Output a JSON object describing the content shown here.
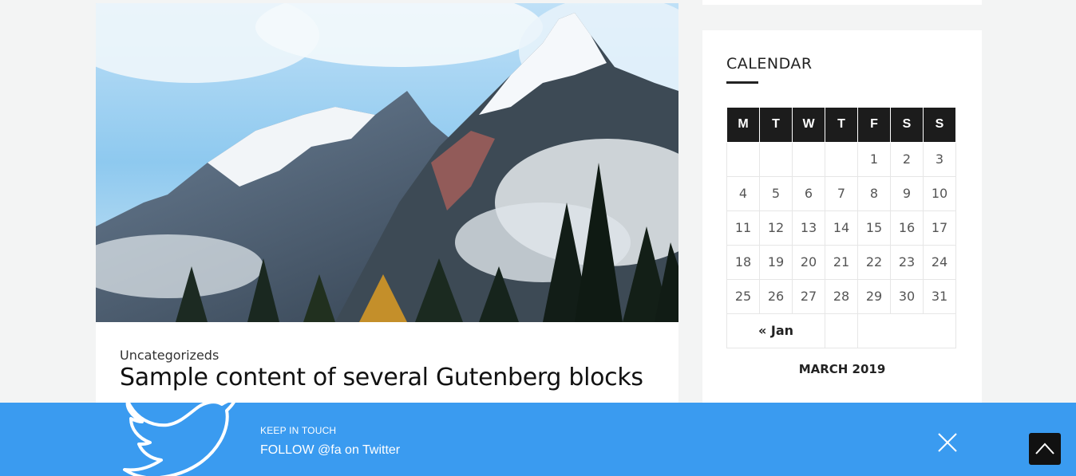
{
  "post": {
    "category": "Uncategorizeds",
    "title": "Sample content of several Gutenberg blocks",
    "image_icon": "mountain-landscape-photo"
  },
  "sidebar": {
    "calendar": {
      "title": "CALENDAR",
      "weekdays": [
        "M",
        "T",
        "W",
        "T",
        "F",
        "S",
        "S"
      ],
      "weeks": [
        [
          "",
          "",
          "",
          "",
          "1",
          "2",
          "3"
        ],
        [
          "4",
          "5",
          "6",
          "7",
          "8",
          "9",
          "10"
        ],
        [
          "11",
          "12",
          "13",
          "14",
          "15",
          "16",
          "17"
        ],
        [
          "18",
          "19",
          "20",
          "21",
          "22",
          "23",
          "24"
        ],
        [
          "25",
          "26",
          "27",
          "28",
          "29",
          "30",
          "31"
        ]
      ],
      "prev_link": "« Jan",
      "caption": "MARCH 2019"
    }
  },
  "twitter_bar": {
    "keep_label": "KEEP IN TOUCH",
    "follow_text": "FOLLOW @fa on Twitter",
    "bird_icon": "twitter-bird-icon",
    "close_icon": "close-icon",
    "background": "#3a9bf0"
  },
  "scroll_top": {
    "icon": "chevron-up-icon"
  }
}
